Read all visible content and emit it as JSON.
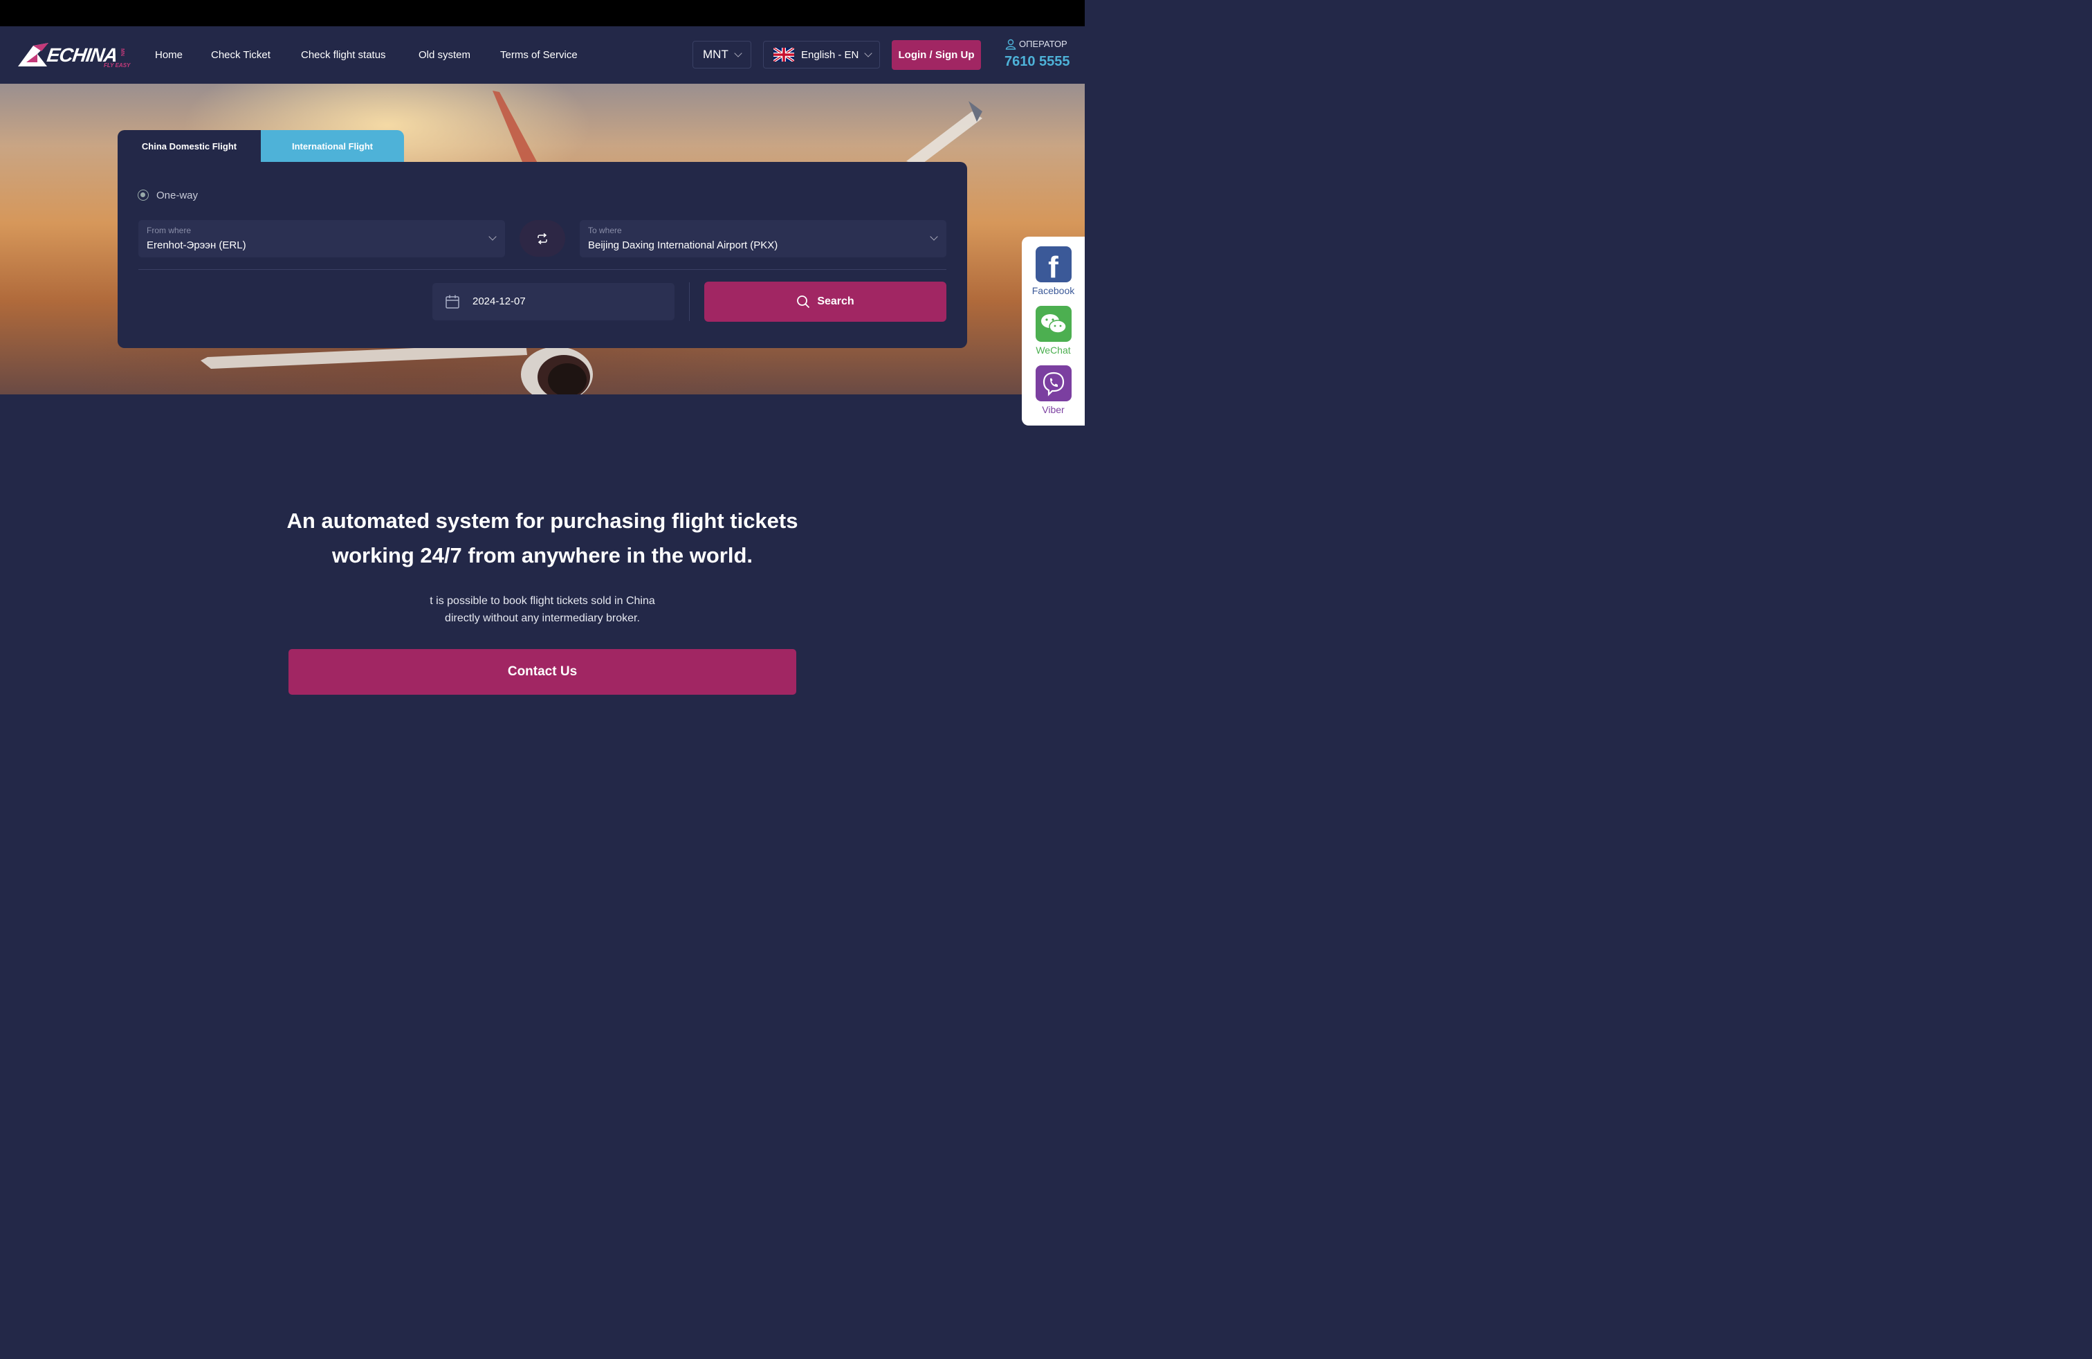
{
  "header": {
    "logo_text": "ECHINA",
    "logo_tagline": "FLY EASY",
    "logo_side": "MN",
    "nav": [
      "Home",
      "Check Ticket",
      "Check flight status",
      "Old system",
      "Terms of Service"
    ],
    "currency": "MNT",
    "language": "English - EN",
    "login_label": "Login / Sign Up",
    "operator_label": "ОПЕРАТОР",
    "operator_phone": "7610 5555"
  },
  "search": {
    "tabs": [
      "China Domestic Flight",
      "International Flight"
    ],
    "active_tab": "International Flight",
    "trip_type": "One-way",
    "from_label": "From where",
    "from_value": "Erenhot-Эрээн (ERL)",
    "to_label": "To where",
    "to_value": "Beijing Daxing International Airport (PKX)",
    "date": "2024-12-07",
    "search_label": "Search"
  },
  "social": [
    {
      "name": "Facebook",
      "color": "#3b5998",
      "icon": "facebook-icon"
    },
    {
      "name": "WeChat",
      "color": "#4caf50",
      "icon": "wechat-icon"
    },
    {
      "name": "Viber",
      "color": "#7b3fa0",
      "icon": "viber-icon"
    }
  ],
  "main": {
    "headline_1": "An automated system for purchasing flight tickets",
    "headline_2": "working 24/7 from anywhere in the world.",
    "sub_1": "t is possible to book flight tickets sold in China",
    "sub_2": "directly without any intermediary broker.",
    "contact_label": "Contact Us"
  },
  "colors": {
    "background": "#232848",
    "accent": "#a12663",
    "secondary": "#4eb2d8"
  }
}
